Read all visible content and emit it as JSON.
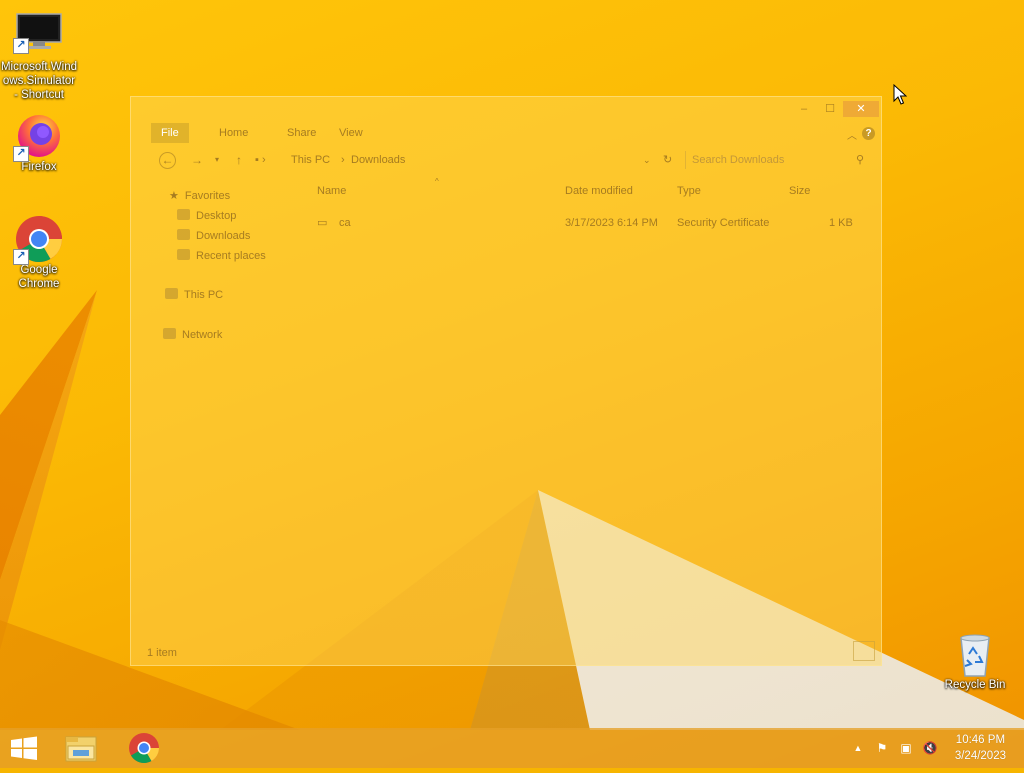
{
  "desktop_icons": [
    {
      "label": "Microsoft.Windows.Simulator - Shortcut",
      "icon": "monitor-icon"
    },
    {
      "label": "Firefox",
      "icon": "firefox-icon"
    },
    {
      "label": "Google Chrome",
      "icon": "chrome-icon"
    },
    {
      "label": "Recycle Bin",
      "icon": "recycle-bin-icon"
    }
  ],
  "explorer": {
    "controls": {
      "minimize": "–",
      "maximize": "☐",
      "close": "✕"
    },
    "ribbon_tabs": [
      "File",
      "Home",
      "Share",
      "View"
    ],
    "address": {
      "crumbs": [
        "This PC",
        "Downloads"
      ],
      "separator": "›"
    },
    "search_placeholder": "Search Downloads",
    "nav": {
      "favorites": "Favorites",
      "desktop": "Desktop",
      "downloads": "Downloads",
      "recent": "Recent places",
      "this_pc": "This PC",
      "network": "Network"
    },
    "columns": {
      "name": "Name",
      "date": "Date modified",
      "type": "Type",
      "size": "Size"
    },
    "files": [
      {
        "name": "ca",
        "date": "3/17/2023 6:14 PM",
        "type": "Security Certificate",
        "size": "1 KB"
      }
    ],
    "status": "1 item"
  },
  "taskbar": {
    "pinned": [
      "start-button",
      "file-explorer",
      "google-chrome"
    ],
    "clock": {
      "time": "10:46 PM",
      "date": "3/24/2023"
    }
  },
  "colors": {
    "wallpaper": "#f7b500",
    "taskbar": "#e6a028"
  }
}
